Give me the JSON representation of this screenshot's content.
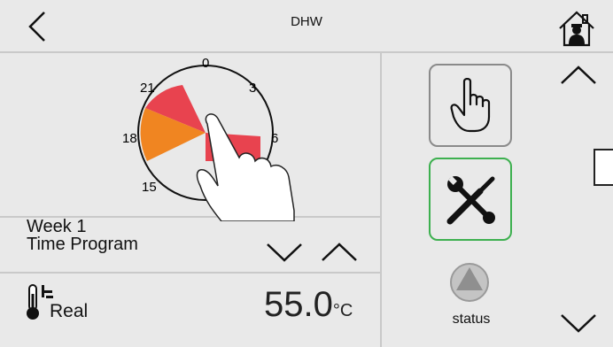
{
  "header": {
    "title": "DHW"
  },
  "clock": {
    "labels": [
      "0",
      "3",
      "6",
      "15",
      "18",
      "21"
    ]
  },
  "program": {
    "line1": "Week 1",
    "line2": "Time Program"
  },
  "temperature": {
    "value": "55.0",
    "unit": "°C",
    "label": "Real"
  },
  "status": {
    "label": "status"
  },
  "colors": {
    "red_segment": "#e8434f",
    "orange_segment": "#f08521",
    "service_border": "#3db04f",
    "manual_border": "#8a8a8a"
  }
}
